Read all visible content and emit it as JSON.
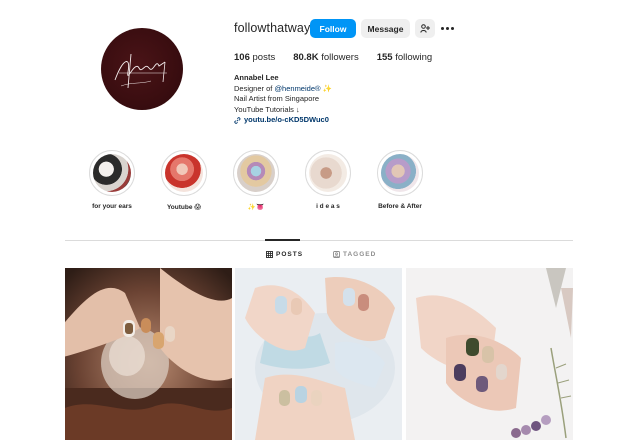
{
  "profile": {
    "username": "followthatway",
    "follow_label": "Follow",
    "message_label": "Message",
    "suggest_label": "+‹",
    "stats": {
      "posts_count": "106",
      "posts_label": " posts",
      "followers_count": "80.8K",
      "followers_label": " followers",
      "following_count": "155",
      "following_label": " following"
    },
    "bio": {
      "name": "Annabel Lee",
      "designer_prefix": "Designer of ",
      "designer_mention": "@henmeide®",
      "designer_suffix": " ✨",
      "line2": "Nail Artist from Singapore",
      "line3": "YouTube Tutorials ↓",
      "link": "youtu.be/o-cKD5DWuc0"
    }
  },
  "highlights": [
    {
      "label": "for your ears",
      "palette": [
        "#2b2b2b",
        "#d9d4cf",
        "#9a3c3a"
      ]
    },
    {
      "label": "Youtube 😱",
      "palette": [
        "#c9342c",
        "#f1c8b9",
        "#e5776b"
      ]
    },
    {
      "label": "✨👅",
      "palette": [
        "#a7d2e3",
        "#b58ab8",
        "#e3c9a1"
      ]
    },
    {
      "label": "i d e a s",
      "palette": [
        "#e8d9cf",
        "#c79b86",
        "#f3ebe4"
      ]
    },
    {
      "label": "Before & After",
      "palette": [
        "#b79cc9",
        "#e2c7b6",
        "#8ab0c7"
      ]
    }
  ],
  "tabs": {
    "posts_label": "POSTS",
    "tagged_label": "TAGGED"
  },
  "colors": {
    "primary_button": "#0095f6",
    "secondary_button": "#efefef",
    "link": "#00376b",
    "text": "#262626",
    "muted": "#8e8e8e"
  }
}
